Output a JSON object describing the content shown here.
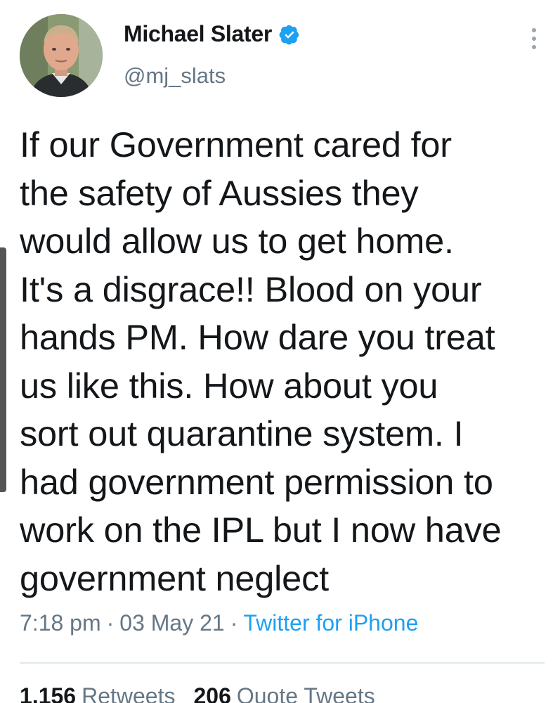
{
  "author": {
    "name": "Michael Slater",
    "handle": "@mj_slats",
    "verified": true,
    "verified_color": "#1da1f2"
  },
  "icons": {
    "avatar": "profile-photo",
    "verified": "verified-badge-icon",
    "more": "more-vertical-icon"
  },
  "tweet": {
    "text": "If our Government cared for\nthe safety of Aussies they\nwould allow us to get home.\nIt's a disgrace!! Blood on your\nhands PM. How dare you treat\nus like this. How about you\nsort out quarantine system. I\nhad government permission to\nwork on the IPL but I now have\ngovernment neglect",
    "time": "7:18 pm",
    "date": "03 May 21",
    "separator": "·",
    "source": "Twitter for iPhone"
  },
  "stats": {
    "retweets_count": "1,156",
    "retweets_label": "Retweets",
    "quotes_count": "206",
    "quotes_label": "Quote Tweets"
  },
  "colors": {
    "text": "#14171a",
    "secondary": "#657786",
    "link": "#1da1f2",
    "divider": "#e1e8ed"
  }
}
